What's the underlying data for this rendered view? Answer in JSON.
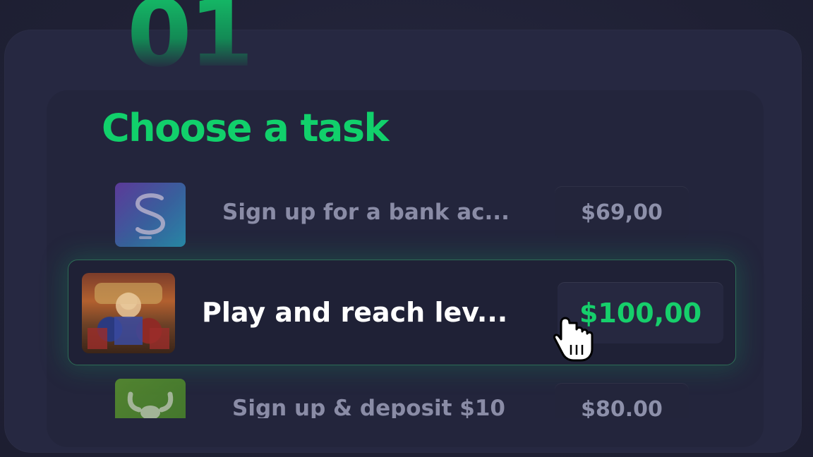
{
  "step": {
    "number": "01"
  },
  "section": {
    "title": "Choose a task"
  },
  "tasks": [
    {
      "label": "Sign up for a bank ac...",
      "reward": "$69,00",
      "icon": "bank-app-icon",
      "state": "dim"
    },
    {
      "label": "Play and reach lev...",
      "reward": "$100,00",
      "icon": "slot-game-icon",
      "state": "active"
    },
    {
      "label": "Sign up & deposit $10",
      "reward": "$80.00",
      "icon": "bull-logo-icon",
      "state": "dim"
    }
  ],
  "colors": {
    "accent": "#11d06b",
    "background": "#1f2034",
    "card": "#262841",
    "muted_text": "#8a8ca6"
  }
}
